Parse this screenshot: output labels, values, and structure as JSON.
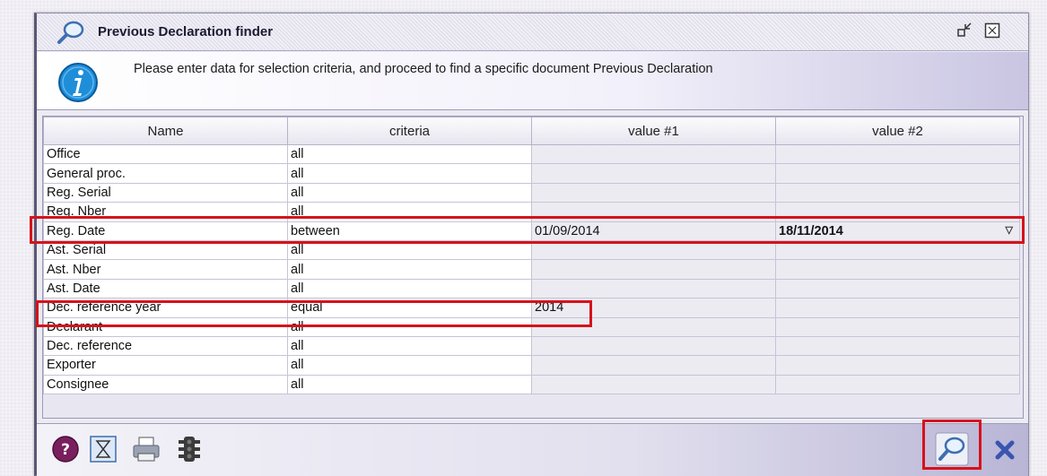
{
  "window": {
    "title": "Previous Declaration finder",
    "info_text": "Please enter data for selection criteria, and proceed to find a specific document Previous Declaration"
  },
  "grid": {
    "columns": [
      "Name",
      "criteria",
      "value #1",
      "value #2"
    ],
    "rows": [
      {
        "name": "Office",
        "criteria": "all",
        "value1": "",
        "value2": ""
      },
      {
        "name": "General proc.",
        "criteria": "all",
        "value1": "",
        "value2": ""
      },
      {
        "name": "Reg. Serial",
        "criteria": "all",
        "value1": "",
        "value2": ""
      },
      {
        "name": "Reg. Nber",
        "criteria": "all",
        "value1": "",
        "value2": ""
      },
      {
        "name": "Reg. Date",
        "criteria": "between",
        "value1": "01/09/2014",
        "value2": "18/11/2014"
      },
      {
        "name": "Ast. Serial",
        "criteria": "all",
        "value1": "",
        "value2": ""
      },
      {
        "name": "Ast. Nber",
        "criteria": "all",
        "value1": "",
        "value2": ""
      },
      {
        "name": "Ast. Date",
        "criteria": "all",
        "value1": "",
        "value2": ""
      },
      {
        "name": "Dec. reference year",
        "criteria": "equal",
        "value1": "2014",
        "value2": ""
      },
      {
        "name": "Declarant",
        "criteria": "all",
        "value1": "",
        "value2": ""
      },
      {
        "name": "Dec. reference",
        "criteria": "all",
        "value1": "",
        "value2": ""
      },
      {
        "name": "Exporter",
        "criteria": "all",
        "value1": "",
        "value2": ""
      },
      {
        "name": "Consignee",
        "criteria": "all",
        "value1": "",
        "value2": ""
      }
    ]
  },
  "colors": {
    "highlight": "#d6121b",
    "accent": "#5a5874",
    "info_blue": "#1f8ed8"
  },
  "icons": {
    "title": "magnifier-icon",
    "info": "info-icon",
    "help": "help-icon",
    "clear": "hourglass-icon",
    "print": "printer-icon",
    "traffic": "traffic-light-icon",
    "find": "magnifier-icon",
    "close": "close-icon"
  }
}
